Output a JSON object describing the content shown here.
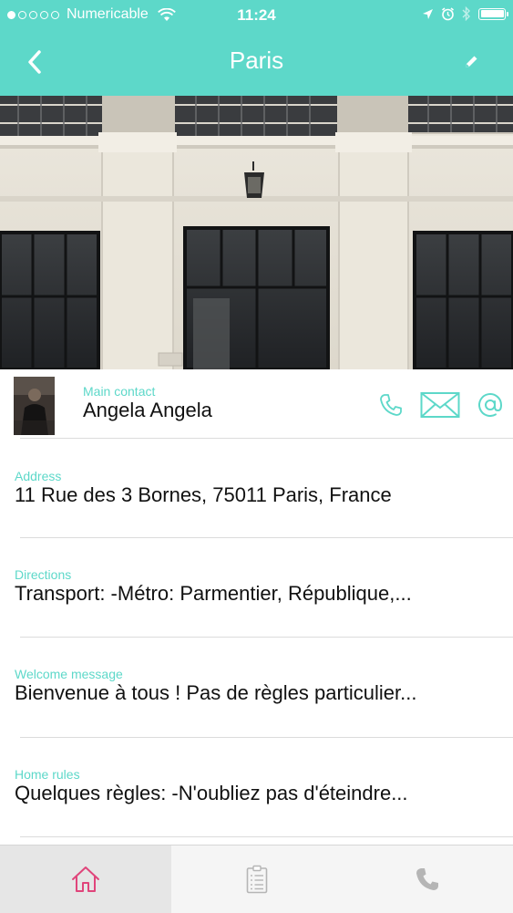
{
  "status_bar": {
    "carrier": "Numericable",
    "time": "11:24"
  },
  "nav": {
    "title": "Paris"
  },
  "contact": {
    "label": "Main contact",
    "name": "Angela Angela"
  },
  "fields": [
    {
      "label": "Address",
      "value": "11 Rue des 3 Bornes, 75011 Paris, France"
    },
    {
      "label": "Directions",
      "value": "Transport:  -Métro: Parmentier, République,..."
    },
    {
      "label": "Welcome message",
      "value": "Bienvenue à tous !  Pas de règles particulier..."
    },
    {
      "label": "Home rules",
      "value": "Quelques règles:  -N'oubliez pas d'éteindre..."
    }
  ],
  "tabs": [
    {
      "icon": "home-icon",
      "active": true
    },
    {
      "icon": "checklist-icon",
      "active": false
    },
    {
      "icon": "phone-icon",
      "active": false
    }
  ],
  "colors": {
    "accent": "#5dd8c9",
    "tab_active": "#e0457b",
    "tab_inactive": "#b5b5b5"
  }
}
